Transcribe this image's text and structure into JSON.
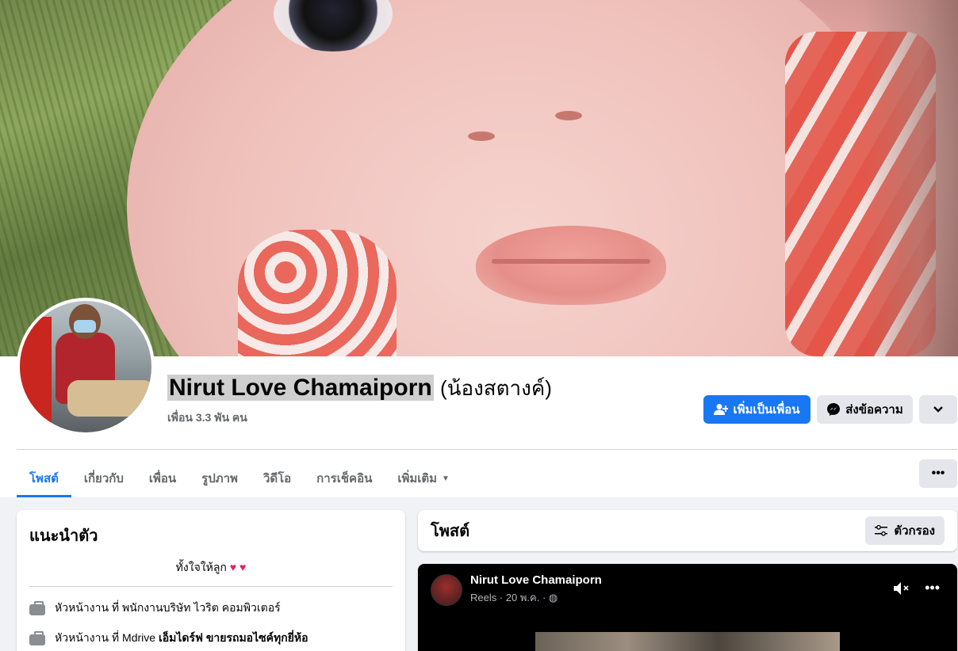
{
  "profile": {
    "name": "Nirut Love Chamaiporn",
    "alt_name": "(น้องสตางค์)",
    "friends": "เพื่อน 3.3 พัน คน"
  },
  "actions": {
    "add_friend": "เพิ่มเป็นเพื่อน",
    "message": "ส่งข้อความ",
    "chevron_icon": "chevron-down-icon",
    "more_icon": "•••"
  },
  "tabs": [
    {
      "label": "โพสต์",
      "active": true
    },
    {
      "label": "เกี่ยวกับ"
    },
    {
      "label": "เพื่อน"
    },
    {
      "label": "รูปภาพ"
    },
    {
      "label": "วิดีโอ"
    },
    {
      "label": "การเช็คอิน"
    },
    {
      "label": "เพิ่มเติม"
    }
  ],
  "intro": {
    "title": "แนะนำตัว",
    "bio": "ทั้งใจให้ลูก",
    "rows": [
      {
        "prefix": "หัวหน้างาน ที่ พนักงานบริษัท ไวริต คอมพิวเตอร์",
        "strong": ""
      },
      {
        "prefix": "หัวหน้างาน ที่ Mdrive",
        "strong": "เอ็มไดร์ฟ ขายรถมอไซค์ทุกยี่ห้อ"
      }
    ]
  },
  "posts": {
    "title": "โพสต์",
    "filter": "ตัวกรอง"
  },
  "reel": {
    "author": "Nirut Love Chamaiporn",
    "meta": "Reels · 20 พ.ค. ·"
  },
  "colors": {
    "primary": "#1877f2",
    "secondary_bg": "#e4e6eb",
    "page_bg": "#f0f2f5"
  }
}
